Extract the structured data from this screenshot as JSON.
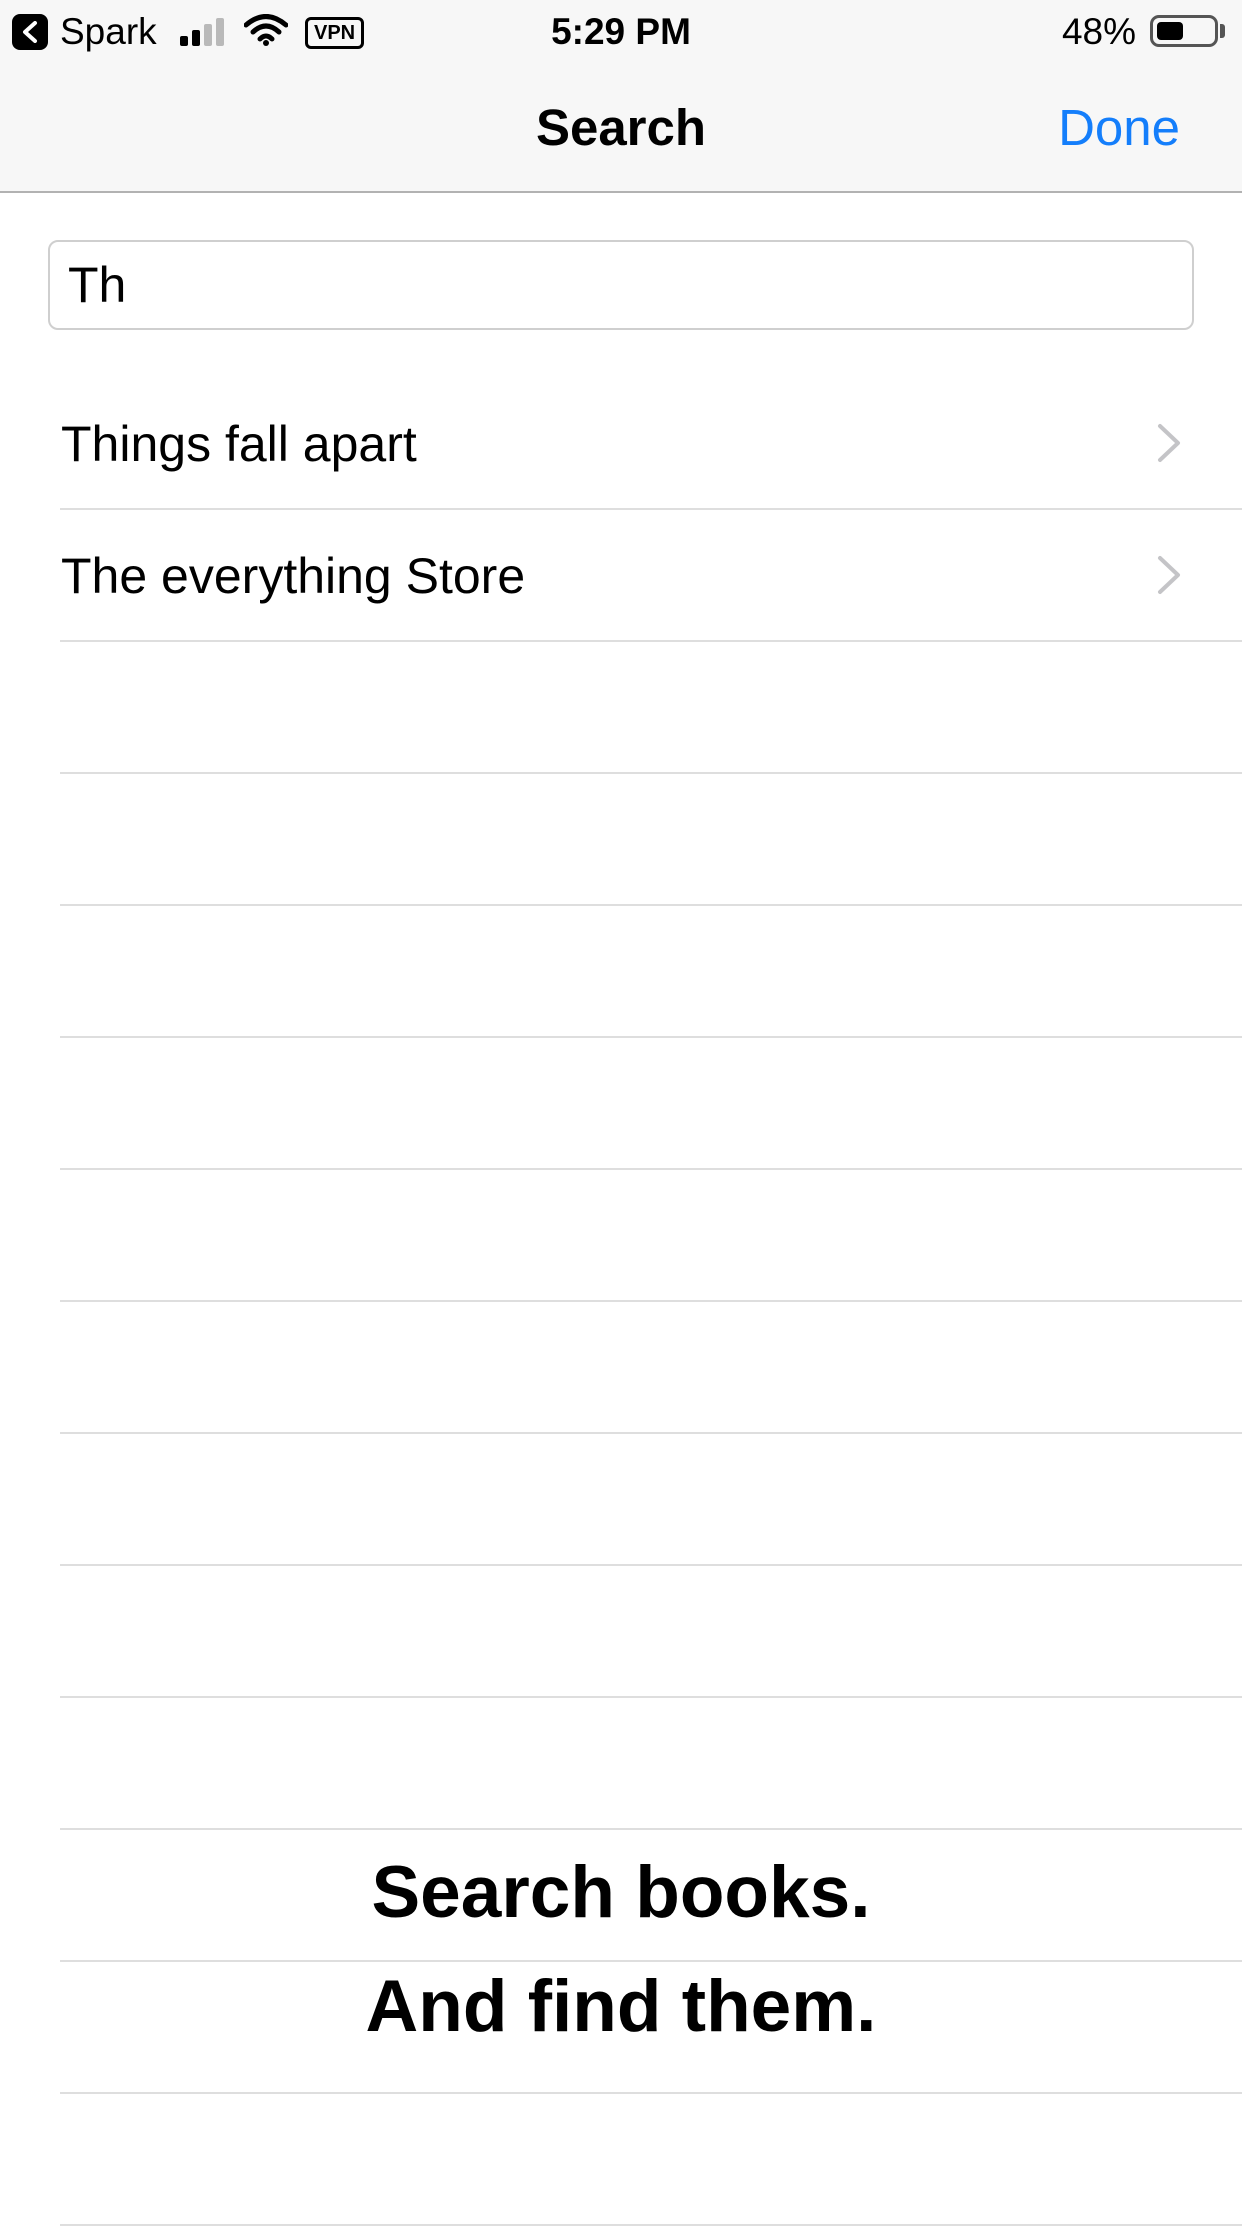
{
  "status_bar": {
    "back_app": "Spark",
    "time": "5:29 PM",
    "vpn": "VPN",
    "battery_percent": "48%",
    "battery_level": 0.48,
    "signal_bars_filled": 2,
    "signal_bars_total": 4
  },
  "nav": {
    "title": "Search",
    "done_label": "Done",
    "accent_color": "#147efb"
  },
  "search": {
    "value": "Th"
  },
  "results": [
    {
      "label": "Things fall apart"
    },
    {
      "label": "The everything Store"
    }
  ],
  "tagline": {
    "line1": "Search books.",
    "line2": "And find them."
  },
  "icons": {
    "back": "back-chevron-icon",
    "signal": "cellular-signal-icon",
    "wifi": "wifi-icon",
    "battery": "battery-icon",
    "row_chevron": "chevron-right-icon"
  }
}
